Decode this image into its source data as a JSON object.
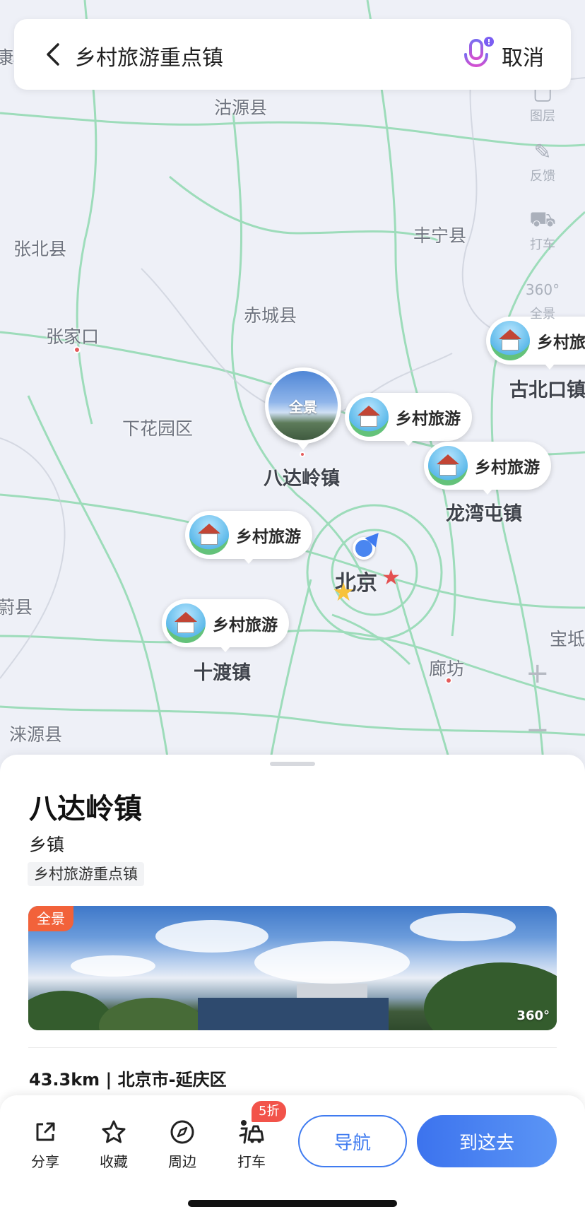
{
  "search": {
    "query": "乡村旅游重点镇",
    "cancel_label": "取消"
  },
  "map": {
    "places": [
      {
        "name": "沽源县"
      },
      {
        "name": "张北县"
      },
      {
        "name": "丰宁县"
      },
      {
        "name": "赤城县"
      },
      {
        "name": "张家口"
      },
      {
        "name": "下花园区"
      },
      {
        "name": "蔚县"
      },
      {
        "name": "廊坊"
      },
      {
        "name": "涞源县"
      },
      {
        "name": "宝坻"
      },
      {
        "name": "康保"
      }
    ],
    "city_label": "北京",
    "poi_label": "乡村旅游",
    "pano_label": "全景",
    "towns": [
      "八达岭镇",
      "古北口镇",
      "龙湾屯镇",
      "十渡镇"
    ],
    "tools": [
      {
        "label": "图层",
        "icon": "layers-icon"
      },
      {
        "label": "反馈",
        "icon": "feedback-icon"
      },
      {
        "label": "打车",
        "icon": "taxi-icon"
      },
      {
        "label": "全景",
        "icon": "panorama-360-icon"
      }
    ],
    "zoom_in": "+",
    "zoom_out": "−"
  },
  "detail": {
    "title": "八达岭镇",
    "type": "乡镇",
    "tag": "乡村旅游重点镇",
    "photo_badge": "全景",
    "photo_360": "360°",
    "distance": "43.3km | 北京市-延庆区"
  },
  "actions": {
    "share": "分享",
    "favorite": "收藏",
    "nearby": "周边",
    "taxi": "打车",
    "discount": "5折",
    "navigate": "导航",
    "go": "到这去"
  },
  "colors": {
    "accent": "#3f7bf0",
    "badge": "#f2623a",
    "road": "#8fd9b0"
  }
}
